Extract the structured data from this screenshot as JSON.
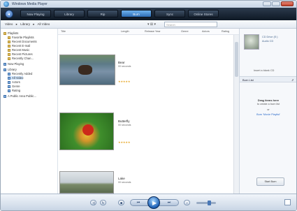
{
  "window": {
    "title": "Windows Media Player"
  },
  "nav": {
    "back_icon": "back-arrow-icon",
    "tabs": [
      {
        "label": "Now Playing",
        "active": false
      },
      {
        "label": "Library",
        "active": false
      },
      {
        "label": "Rip",
        "active": false
      },
      {
        "label": "Burn",
        "active": true
      },
      {
        "label": "Sync",
        "active": false
      },
      {
        "label": "Online Stores",
        "active": false
      }
    ]
  },
  "addressbar": {
    "crumbs": [
      "Video",
      "Library",
      "All Video"
    ],
    "search_placeholder": "Search"
  },
  "navpane": {
    "items": [
      {
        "label": "Playlists",
        "type": "folder"
      },
      {
        "label": "Favorite Playlists",
        "type": "folder"
      },
      {
        "label": "Recent Documents",
        "type": "folder"
      },
      {
        "label": "Recent E-mail",
        "type": "folder"
      },
      {
        "label": "Recent Music",
        "type": "folder"
      },
      {
        "label": "Recent Pictures",
        "type": "folder"
      },
      {
        "label": "Recently Chan...",
        "type": "folder"
      },
      {
        "label": "Now Playing",
        "type": "lib"
      },
      {
        "label": "Library",
        "type": "lib"
      },
      {
        "label": "Recently Added",
        "type": "lib"
      },
      {
        "label": "All Video",
        "type": "lib",
        "selected": true
      },
      {
        "label": "Actors",
        "type": "lib"
      },
      {
        "label": "Genre",
        "type": "lib"
      },
      {
        "label": "Rating",
        "type": "lib"
      },
      {
        "label": "A Public Area Public...",
        "type": "lib"
      }
    ]
  },
  "columns": [
    "Title",
    "Length",
    "Release Year",
    "Genre",
    "Actors",
    "Rating"
  ],
  "videos": [
    {
      "title": "Bear",
      "sub": "00 seconds",
      "stars": "★★★★★"
    },
    {
      "title": "Butterfly",
      "sub": "00 seconds",
      "stars": "★★★★★"
    },
    {
      "title": "Lake",
      "sub": "00 seconds",
      "stars": ""
    }
  ],
  "rightpane": {
    "disc_line1": "CD Drive (E:)",
    "disc_line2": "Audio CD",
    "insert_label": "Insert a blank CD",
    "list_label": "Burn List",
    "drag_title": "Drag items here",
    "drag_sub": "to create a burn list",
    "or": "or",
    "save_link": "Burn 'Movie Playlist'",
    "start_burn": "Start Burn"
  }
}
